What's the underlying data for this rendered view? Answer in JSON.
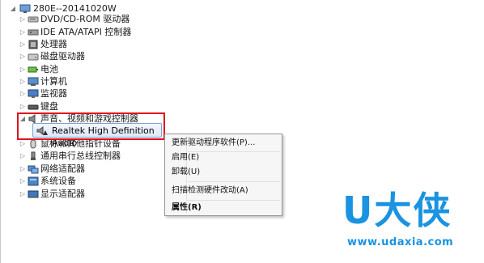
{
  "tree": {
    "root_label": "280E--20141020W",
    "categories": [
      {
        "label": "DVD/CD-ROM 驱动器",
        "icon": "dvd-icon"
      },
      {
        "label": "IDE ATA/ATAPI 控制器",
        "icon": "ide-controller-icon"
      },
      {
        "label": "处理器",
        "icon": "processor-icon"
      },
      {
        "label": "磁盘驱动器",
        "icon": "disk-drive-icon"
      },
      {
        "label": "电池",
        "icon": "battery-icon"
      },
      {
        "label": "计算机",
        "icon": "computer-icon"
      },
      {
        "label": "监视器",
        "icon": "monitor-icon"
      },
      {
        "label": "键盘",
        "icon": "keyboard-icon"
      },
      {
        "label": "声音、视频和游戏控制器",
        "icon": "sound-icon"
      },
      {
        "label": "鼠标和其他指针设备",
        "icon": "mouse-icon"
      },
      {
        "label": "通用串行总线控制器",
        "icon": "usb-icon"
      },
      {
        "label": "网络适配器",
        "icon": "network-icon"
      },
      {
        "label": "系统设备",
        "icon": "system-device-icon"
      },
      {
        "label": "显示适配器",
        "icon": "display-adapter-icon"
      }
    ],
    "selected_device": "Realtek High Definition Audio"
  },
  "context_menu": {
    "update_driver": "更新驱动程序软件(P)...",
    "enable": "启用(E)",
    "uninstall": "卸载(U)",
    "scan": "扫描检测硬件改动(A)",
    "properties": "属性(R)"
  },
  "watermark": {
    "brand": "U大侠",
    "url": "www.udaxia.com",
    "color": "#1a93e0"
  },
  "colors": {
    "highlight_border": "#e0121c"
  }
}
